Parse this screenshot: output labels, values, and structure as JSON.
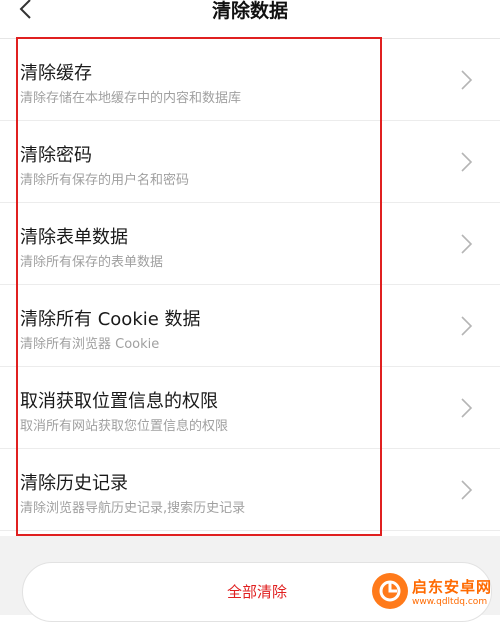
{
  "header": {
    "title": "清除数据"
  },
  "items": [
    {
      "title": "清除缓存",
      "subtitle": "清除存储在本地缓存中的内容和数据库"
    },
    {
      "title": "清除密码",
      "subtitle": "清除所有保存的用户名和密码"
    },
    {
      "title": "清除表单数据",
      "subtitle": "清除所有保存的表单数据"
    },
    {
      "title": "清除所有 Cookie 数据",
      "subtitle": "清除所有浏览器 Cookie"
    },
    {
      "title": "取消获取位置信息的权限",
      "subtitle": "取消所有网站获取您位置信息的权限"
    },
    {
      "title": "清除历史记录",
      "subtitle": "清除浏览器导航历史记录,搜索历史记录"
    }
  ],
  "clear_all_label": "全部清除",
  "watermark": {
    "name": "启东安卓网",
    "url": "www.qdltdq.com"
  },
  "colors": {
    "accent": "#e02020",
    "watermark": "#ff6a00"
  }
}
